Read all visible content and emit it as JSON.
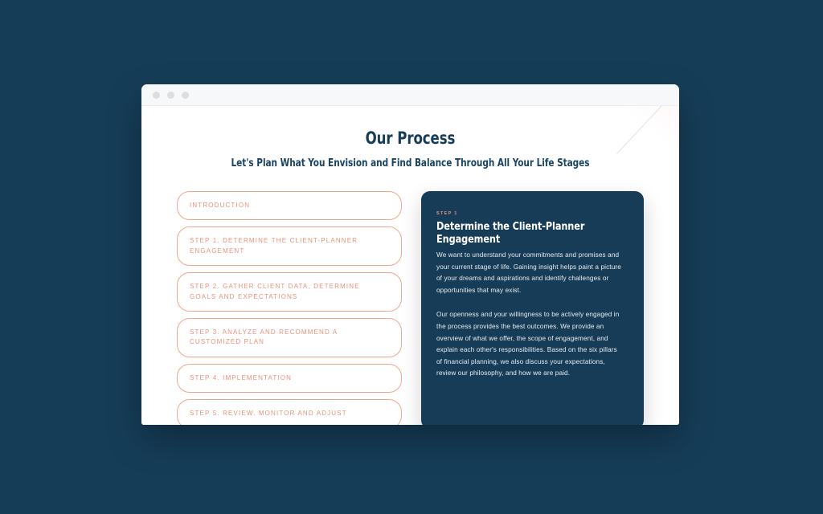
{
  "browser": {
    "dots": [
      "window-close-dot",
      "window-minimize-dot",
      "window-maximize-dot"
    ]
  },
  "header": {
    "title": "Our Process",
    "subtitle": "Let's Plan What You Envision and Find Balance Through All Your Life Stages"
  },
  "accordion": {
    "items": [
      {
        "label": "INTRODUCTION"
      },
      {
        "label": "STEP 1. DETERMINE THE CLIENT-PLANNER ENGAGEMENT"
      },
      {
        "label": "STEP 2. GATHER CLIENT DATA, DETERMINE GOALS AND EXPECTATIONS"
      },
      {
        "label": "STEP 3. ANALYZE AND RECOMMEND A CUSTOMIZED PLAN"
      },
      {
        "label": "STEP 4. IMPLEMENTATION"
      },
      {
        "label": "STEP 5. REVIEW, MONITOR AND ADJUST"
      }
    ]
  },
  "detail": {
    "eyebrow": "STEP 1",
    "title": "Determine the Client-Planner Engagement",
    "paragraph1": "We want to understand your commitments and promises and your current stage of life. Gaining insight helps paint a picture of your dreams and aspirations and identify challenges or opportunities that may exist.",
    "paragraph2": "Our openness and your willingness to be actively engaged in the process provides the best outcomes. We provide an overview of what we offer, the scope of engagement, and explain each other's responsibilities. Based on the six pillars of financial planning, we also discuss your expectations, review our philosophy, and how we are paid."
  },
  "colors": {
    "page_background": "#163d58",
    "panel_navy": "#173c57",
    "accent_coral": "#e8927c",
    "border_coral": "#eda98f",
    "card_white": "#ffffff",
    "chrome_grey": "#f7f8f9"
  }
}
